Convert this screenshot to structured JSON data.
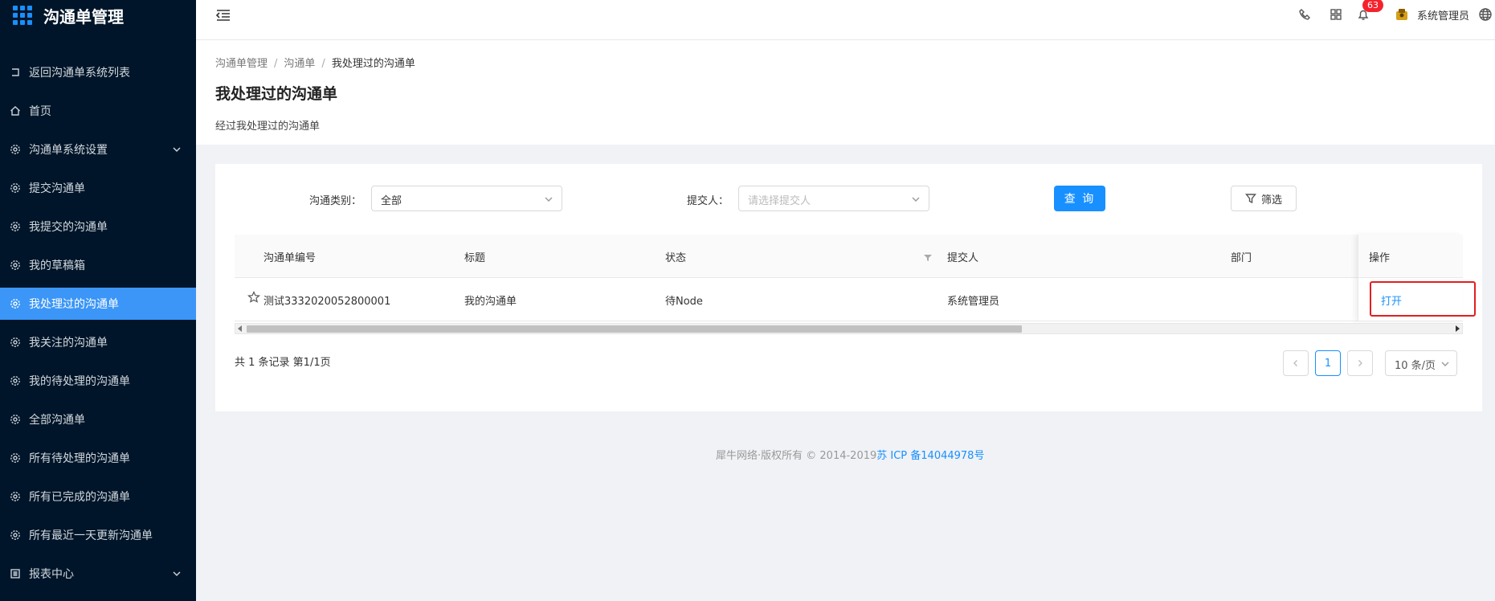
{
  "app": {
    "title": "沟通单管理"
  },
  "sidebar": {
    "items": [
      {
        "label": "返回沟通单系统列表",
        "icon": "return-icon"
      },
      {
        "label": "首页",
        "icon": "home-icon"
      },
      {
        "label": "沟通单系统设置",
        "icon": "gear-icon",
        "expandable": true
      },
      {
        "label": "提交沟通单",
        "icon": "gear-icon"
      },
      {
        "label": "我提交的沟通单",
        "icon": "gear-icon"
      },
      {
        "label": "我的草稿箱",
        "icon": "gear-icon"
      },
      {
        "label": "我处理过的沟通单",
        "icon": "gear-icon",
        "active": true
      },
      {
        "label": "我关注的沟通单",
        "icon": "gear-icon"
      },
      {
        "label": "我的待处理的沟通单",
        "icon": "gear-icon"
      },
      {
        "label": "全部沟通单",
        "icon": "gear-icon"
      },
      {
        "label": "所有待处理的沟通单",
        "icon": "gear-icon"
      },
      {
        "label": "所有已完成的沟通单",
        "icon": "gear-icon"
      },
      {
        "label": "所有最近一天更新沟通单",
        "icon": "gear-icon"
      },
      {
        "label": "报表中心",
        "icon": "report-icon",
        "expandable": true
      }
    ]
  },
  "header": {
    "notification_count": "63",
    "username": "系统管理员"
  },
  "breadcrumb": [
    "沟通单管理",
    "沟通单",
    "我处理过的沟通单"
  ],
  "page": {
    "title": "我处理过的沟通单",
    "description": "经过我处理过的沟通单"
  },
  "filters": {
    "category_label": "沟通类别：",
    "category_value": "全部",
    "submitter_label": "提交人：",
    "submitter_placeholder": "请选择提交人",
    "query_button": "查 询",
    "filter_button": "筛选"
  },
  "table": {
    "columns": [
      "沟通单编号",
      "标题",
      "状态",
      "提交人",
      "部门",
      "操作"
    ],
    "rows": [
      {
        "id": "测试3332020052800001",
        "title": "我的沟通单",
        "status": "待Node",
        "submitter": "系统管理员",
        "dept": "",
        "action": "打开"
      }
    ]
  },
  "pagination": {
    "summary": "共 1 条记录 第1/1页",
    "current_page": "1",
    "page_size": "10 条/页"
  },
  "footer": {
    "copyright": "犀牛网络·版权所有 © 2014-2019",
    "icp": "苏 ICP 备14044978号"
  },
  "colors": {
    "sidebar_bg": "#001529",
    "accent": "#1890ff",
    "active_item": "#3b96f7",
    "badge": "#f5222d",
    "highlight_box": "#e02020"
  }
}
